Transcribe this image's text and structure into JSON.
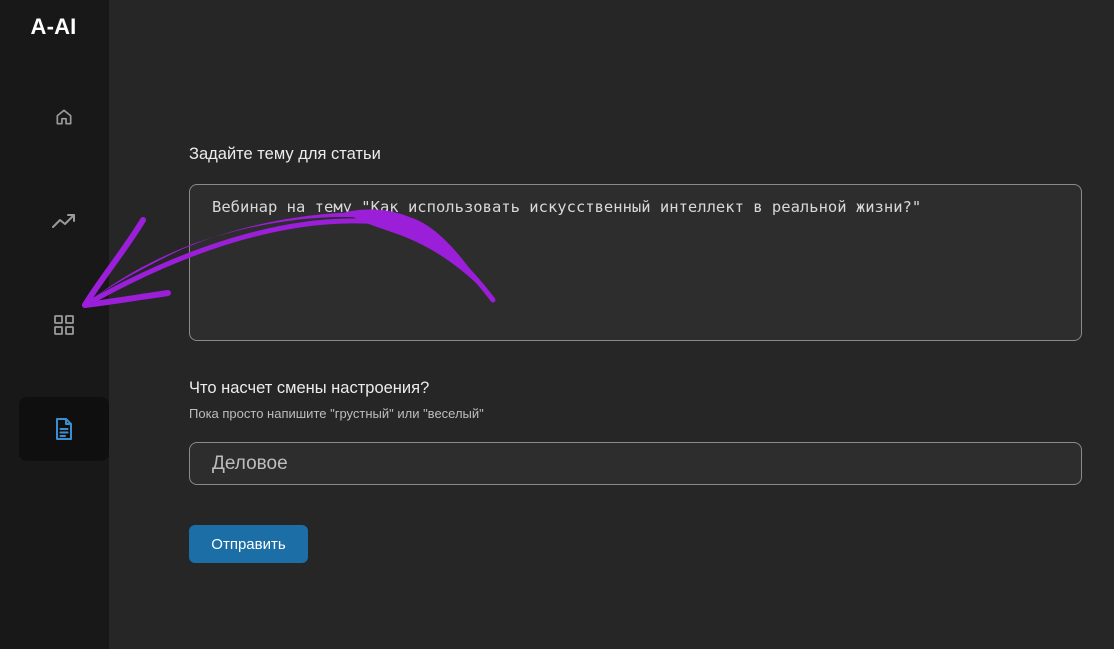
{
  "app": {
    "brand": "A-AI"
  },
  "sidebar": {
    "items": [
      {
        "icon": "home-icon",
        "active": false
      },
      {
        "icon": "trending-up-icon",
        "active": false
      },
      {
        "icon": "grid-icon",
        "active": false
      },
      {
        "icon": "document-icon",
        "active": true
      }
    ]
  },
  "form": {
    "topic_label": "Задайте тему для статьи",
    "topic_value": "Вебинар на тему \"Как использовать искусственный интеллект в реальной жизни?\"",
    "mood_label": "Что насчет смены настроения?",
    "mood_hint": "Пока просто напишите \"грустный\" или \"веселый\"",
    "mood_placeholder": "Деловое",
    "submit_label": "Отправить"
  },
  "colors": {
    "background": "#262626",
    "sidebar": "#181818",
    "accent_button": "#1c6fa6",
    "active_icon": "#3b8fd0",
    "annotation_arrow": "#9b1fd8"
  }
}
